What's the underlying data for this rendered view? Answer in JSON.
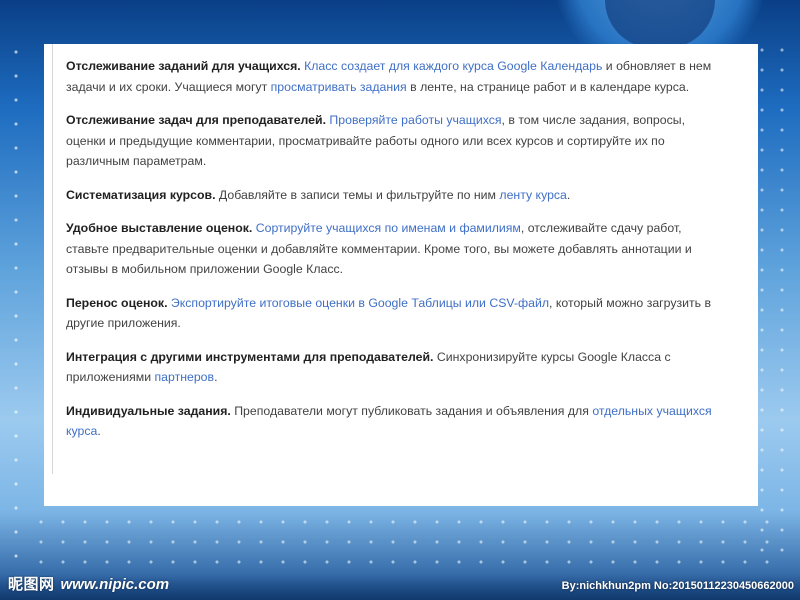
{
  "document": {
    "paragraphs": [
      {
        "segments": [
          {
            "text": "Отслеживание заданий для учащихся.",
            "style": "bold"
          },
          {
            "text": " ",
            "style": "plain"
          },
          {
            "text": "Класс создает для каждого курса Google Календарь",
            "style": "link"
          },
          {
            "text": " и обновляет в нем задачи и их сроки. Учащиеся могут ",
            "style": "plain"
          },
          {
            "text": "просматривать задания",
            "style": "link"
          },
          {
            "text": " в ленте, на странице работ и в календаре курса.",
            "style": "plain"
          }
        ]
      },
      {
        "segments": [
          {
            "text": "Отслеживание задач для преподавателей.",
            "style": "bold"
          },
          {
            "text": " ",
            "style": "plain"
          },
          {
            "text": "Проверяйте работы учащихся",
            "style": "link"
          },
          {
            "text": ", в том числе задания, вопросы, оценки и предыдущие комментарии, просматривайте работы одного или всех курсов и сортируйте их по различным параметрам.",
            "style": "plain"
          }
        ]
      },
      {
        "segments": [
          {
            "text": "Систематизация курсов.",
            "style": "bold"
          },
          {
            "text": " Добавляйте в записи темы и фильтруйте по ним ",
            "style": "plain"
          },
          {
            "text": "ленту курса",
            "style": "link"
          },
          {
            "text": ".",
            "style": "plain"
          }
        ]
      },
      {
        "segments": [
          {
            "text": "Удобное выставление оценок.",
            "style": "bold"
          },
          {
            "text": " ",
            "style": "plain"
          },
          {
            "text": "Сортируйте учащихся по именам и фамилиям",
            "style": "link"
          },
          {
            "text": ", отслеживайте сдачу работ, ставьте предварительные оценки и добавляйте комментарии. Кроме того, вы можете добавлять аннотации и отзывы в мобильном приложении Google Класс.",
            "style": "plain"
          }
        ]
      },
      {
        "segments": [
          {
            "text": "Перенос оценок.",
            "style": "bold"
          },
          {
            "text": " ",
            "style": "plain"
          },
          {
            "text": "Экспортируйте итоговые оценки в Google Таблицы или CSV-файл",
            "style": "link"
          },
          {
            "text": ", который можно загрузить в другие приложения.",
            "style": "plain"
          }
        ]
      },
      {
        "segments": [
          {
            "text": "Интеграция с другими инструментами для преподавателей.",
            "style": "bold"
          },
          {
            "text": " Синхронизируйте курсы Google Класса с приложениями ",
            "style": "plain"
          },
          {
            "text": "партнеров",
            "style": "link"
          },
          {
            "text": ".",
            "style": "plain"
          }
        ]
      },
      {
        "segments": [
          {
            "text": "Индивидуальные задания.",
            "style": "bold"
          },
          {
            "text": " Преподаватели могут публиковать задания и объявления для ",
            "style": "plain"
          },
          {
            "text": "отдельных учащихся курса",
            "style": "link"
          },
          {
            "text": ".",
            "style": "plain"
          }
        ]
      }
    ]
  },
  "watermark": {
    "logo": "昵图网",
    "url": "www.nipic.com",
    "credit": "By:nichkhun2pm No:20150112230450662000"
  },
  "colors": {
    "link": "#3f6fc6",
    "text": "#424242",
    "bold": "#212121",
    "background_top": "#0a3f86",
    "background_mid": "#9ccaef"
  }
}
